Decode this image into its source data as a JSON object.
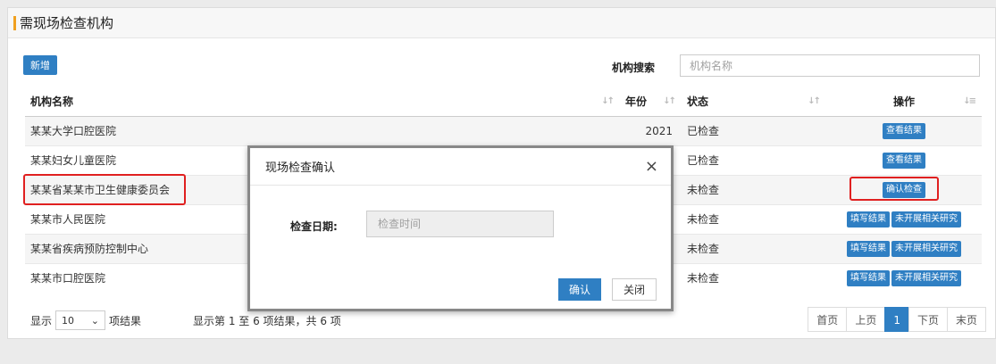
{
  "panel": {
    "title": "需现场检查机构"
  },
  "toolbar": {
    "add_label": "新增",
    "search_label": "机构搜索",
    "search_placeholder": "机构名称"
  },
  "table": {
    "headers": [
      "机构名称",
      "年份",
      "状态",
      "操作"
    ],
    "rows": [
      {
        "name": "某某大学口腔医院",
        "year": "2021",
        "state": "已检查",
        "ops": [
          "查看结果"
        ]
      },
      {
        "name": "某某妇女儿童医院",
        "year": "",
        "state": "已检查",
        "ops": [
          "查看结果"
        ]
      },
      {
        "name": "某某省某某市卫生健康委员会",
        "year": "",
        "state": "未检查",
        "ops": [
          "确认检查"
        ]
      },
      {
        "name": "某某市人民医院",
        "year": "",
        "state": "未检查",
        "ops": [
          "填写结果",
          "未开展相关研究"
        ]
      },
      {
        "name": "某某省疾病预防控制中心",
        "year": "",
        "state": "未检查",
        "ops": [
          "填写结果",
          "未开展相关研究"
        ]
      },
      {
        "name": "某某市口腔医院",
        "year": "",
        "state": "未检查",
        "ops": [
          "填写结果",
          "未开展相关研究"
        ]
      }
    ]
  },
  "footer": {
    "show_label": "显示",
    "page_size": "10",
    "items_label": "项结果",
    "info": "显示第 1 至 6 项结果，共 6 项"
  },
  "pager": {
    "first": "首页",
    "prev": "上页",
    "current": "1",
    "next": "下页",
    "last": "末页"
  },
  "modal": {
    "title": "现场检查确认",
    "close_icon": "×",
    "date_label": "检查日期:",
    "date_placeholder": "检查时间",
    "ok_label": "确认",
    "close_label": "关闭"
  },
  "colors": {
    "accent": "#2f7fc3",
    "highlight": "#e02020",
    "title_bar": "#f0a020"
  }
}
